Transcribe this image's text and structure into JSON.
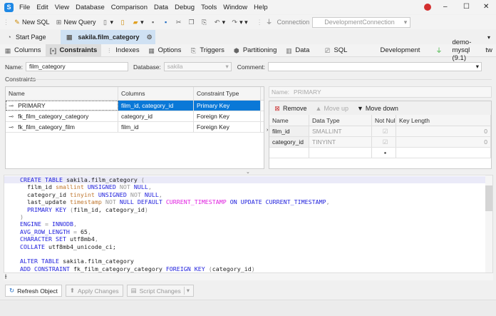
{
  "menu": [
    "File",
    "Edit",
    "View",
    "Database",
    "Comparison",
    "Data",
    "Debug",
    "Tools",
    "Window",
    "Help"
  ],
  "toolbar": {
    "new_sql": "New SQL",
    "new_query": "New Query",
    "connection_label": "Connection",
    "connection_value": "DevelopmentConnection"
  },
  "doc_tabs": [
    {
      "label": "Start Page"
    },
    {
      "label": "sakila.film_category"
    }
  ],
  "sub_tabs": [
    "Columns",
    "Constraints",
    "Indexes",
    "Options",
    "Triggers",
    "Partitioning",
    "Data",
    "SQL"
  ],
  "env": {
    "label": "Development",
    "connection": "demo-mysql (9.1)",
    "db": "tw",
    "env_color": "#22bb22"
  },
  "form": {
    "name_label": "Name:",
    "name_value": "film_category",
    "database_label": "Database:",
    "database_value": "sakila",
    "comment_label": "Comment:",
    "comment_value": ""
  },
  "constraints": {
    "section_label": "Constraints",
    "headers": [
      "Name",
      "Columns",
      "Constraint Type"
    ],
    "rows": [
      {
        "name": "PRIMARY",
        "columns": "film_id, category_id",
        "type": "Primary Key"
      },
      {
        "name": "fk_film_category_category",
        "columns": "category_id",
        "type": "Foreign Key"
      },
      {
        "name": "fk_film_category_film",
        "columns": "film_id",
        "type": "Foreign Key"
      }
    ]
  },
  "detail": {
    "name_label": "Name:",
    "name_value": "PRIMARY",
    "remove": "Remove",
    "move_up": "Move up",
    "move_down": "Move down",
    "headers": [
      "Name",
      "Data Type",
      "Not Null",
      "Key Length"
    ],
    "rows": [
      {
        "name": "film_id",
        "type": "SMALLINT",
        "not_null": true,
        "key_length": "0"
      },
      {
        "name": "category_id",
        "type": "TINYINT",
        "not_null": true,
        "key_length": "0"
      }
    ]
  },
  "code": [
    [
      [
        "CREATE TABLE ",
        "kw"
      ],
      [
        "sakila.film_category ",
        "id"
      ],
      [
        "(",
        "pu"
      ]
    ],
    [
      [
        "  film_id ",
        "id"
      ],
      [
        "smallint ",
        "ty"
      ],
      [
        "UNSIGNED ",
        "kw"
      ],
      [
        "NOT ",
        "nt"
      ],
      [
        "NULL",
        "kw"
      ],
      [
        ",",
        "pu"
      ]
    ],
    [
      [
        "  category_id ",
        "id"
      ],
      [
        "tinyint ",
        "ty"
      ],
      [
        "UNSIGNED ",
        "kw"
      ],
      [
        "NOT ",
        "nt"
      ],
      [
        "NULL",
        "kw"
      ],
      [
        ",",
        "pu"
      ]
    ],
    [
      [
        "  last_update ",
        "id"
      ],
      [
        "timestamp ",
        "ty"
      ],
      [
        "NOT ",
        "nt"
      ],
      [
        "NULL DEFAULT ",
        "kw"
      ],
      [
        "CURRENT_TIMESTAMP ",
        "fn"
      ],
      [
        "ON UPDATE CURRENT_TIMESTAMP",
        "kw"
      ],
      [
        ",",
        "pu"
      ]
    ],
    [
      [
        "  PRIMARY KEY ",
        "kw"
      ],
      [
        "(",
        "pu"
      ],
      [
        "film_id, category_id",
        "id"
      ],
      [
        ")",
        "pu"
      ]
    ],
    [
      [
        ")",
        "pu"
      ]
    ],
    [
      [
        "ENGINE ",
        "kw"
      ],
      [
        "= ",
        "pu"
      ],
      [
        "INNODB",
        "kw"
      ],
      [
        ",",
        "pu"
      ]
    ],
    [
      [
        "AVG_ROW_LENGTH ",
        "kw"
      ],
      [
        "= ",
        "pu"
      ],
      [
        "65",
        "id"
      ],
      [
        ",",
        "pu"
      ]
    ],
    [
      [
        "CHARACTER SET ",
        "kw"
      ],
      [
        "utf8mb4",
        "id"
      ],
      [
        ",",
        "pu"
      ]
    ],
    [
      [
        "COLLATE ",
        "kw"
      ],
      [
        "utf8mb4_unicode_ci;",
        "id"
      ]
    ],
    [],
    [
      [
        "ALTER TABLE ",
        "kw"
      ],
      [
        "sakila.film_category",
        "id"
      ]
    ],
    [
      [
        "ADD CONSTRAINT ",
        "kw"
      ],
      [
        "fk_film_category_category ",
        "id"
      ],
      [
        "FOREIGN KEY ",
        "kw"
      ],
      [
        "(",
        "pu"
      ],
      [
        "category_id",
        "id"
      ],
      [
        ")",
        "pu"
      ]
    ]
  ],
  "buttons": {
    "refresh": "Refresh Object",
    "apply": "Apply Changes",
    "script": "Script Changes"
  }
}
